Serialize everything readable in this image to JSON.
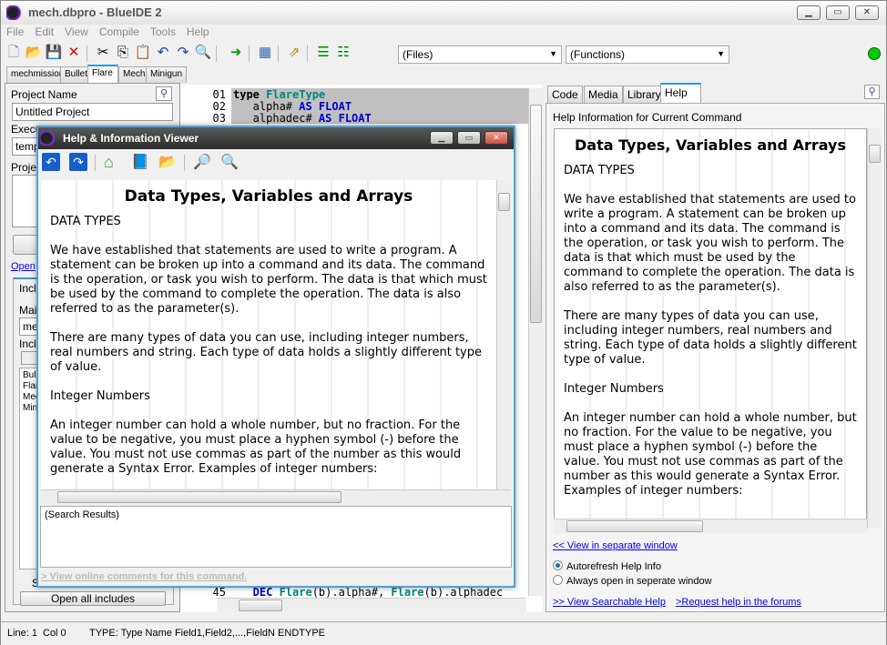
{
  "app": {
    "title": "mech.dbpro - BlueIDE 2",
    "menu": [
      "File",
      "Edit",
      "View",
      "Compile",
      "Tools",
      "Help"
    ],
    "status_color": "#00cc00"
  },
  "toolbar": {
    "icons": [
      "new-file-icon",
      "open-folder-icon",
      "save-icon",
      "close-icon",
      "cut-icon",
      "copy-icon",
      "paste-icon",
      "undo-icon",
      "redo-icon",
      "find-icon",
      "run-icon",
      "window-icon",
      "export-icon",
      "list-icon",
      "list-refresh-icon"
    ],
    "files_combo": "(Files)",
    "functions_combo": "(Functions)"
  },
  "file_tabs": [
    "mechmission",
    "Bullet",
    "Flare",
    "Mech",
    "Minigun"
  ],
  "left": {
    "project_name_label": "Project Name",
    "project_name": "Untitled Project",
    "exec_label": "Execu",
    "exec_value": "temp",
    "project_label": "Projec",
    "open_link": "Open",
    "incl_tab": "Incl",
    "main_label": "Mai",
    "main_value": "me",
    "incl_label": "Incl",
    "incl_button": "N",
    "includes": [
      "Bull",
      "Flar",
      "Mec",
      "Min"
    ],
    "s_label": "S",
    "open_all": "Open all includes"
  },
  "code": {
    "lines": [
      {
        "n": "01",
        "parts": [
          [
            "type ",
            "b"
          ],
          [
            "FlareType",
            "ty"
          ]
        ]
      },
      {
        "n": "02",
        "parts": [
          [
            "   alpha# ",
            ""
          ],
          [
            "AS FLOAT",
            "kw"
          ]
        ]
      },
      {
        "n": "03",
        "parts": [
          [
            "   alphadec# ",
            ""
          ],
          [
            "AS FLOAT",
            "kw"
          ]
        ]
      }
    ],
    "line45": {
      "n": "45",
      "parts": [
        [
          "   DEC ",
          "kw"
        ],
        [
          "Flare",
          "ty"
        ],
        [
          "(b).alpha#, ",
          ""
        ],
        [
          "Flare",
          "ty"
        ],
        [
          "(b).alphadec",
          ""
        ]
      ]
    }
  },
  "right": {
    "tabs": [
      "Code",
      "Media",
      "Library",
      "Help"
    ],
    "active_tab": "Help",
    "heading": "Help Information for Current Command",
    "view_separate": "<< View in separate window",
    "radio_autorefresh": "Autorefresh Help Info",
    "radio_always": "Always open in seperate window",
    "autorefresh_selected": true,
    "view_searchable": ">> View Searchable Help",
    "request_help": ">Request help in the forums"
  },
  "help": {
    "title": "Data Types, Variables and Arrays",
    "paragraphs": [
      "DATA TYPES",
      "We have established that statements are used to write a program. A statement can be broken up into a command and its data. The command is the operation, or task you wish to perform. The data is that which must be used by the command to complete the operation. The data is also referred to as the parameter(s).",
      "There are many types of data you can use, including integer numbers, real numbers and string. Each type of data holds a slightly different type of value.",
      "Integer Numbers",
      "An integer number can hold a whole number, but no fraction. For the value to be negative, you must place a hyphen symbol (-) before the value. You must not use commas as part of the number as this would generate a Syntax Error. Examples of integer numbers:"
    ]
  },
  "dialog": {
    "title": "Help & Information Viewer",
    "icons": [
      "back-icon",
      "forward-icon",
      "home-icon",
      "book-icon",
      "open-folder-icon",
      "search-page-icon",
      "search-icon"
    ],
    "search_results": "(Search Results)",
    "online_comments": "> View online comments for this command."
  },
  "status": {
    "line": "Line: 1",
    "col": "Col 0",
    "hint": "TYPE: Type Name Field1,Field2,...,FieldN ENDTYPE"
  }
}
